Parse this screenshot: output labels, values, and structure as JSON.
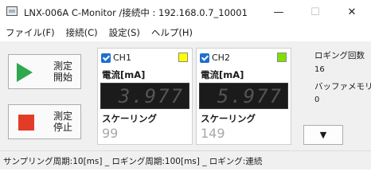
{
  "window": {
    "title": "LNX-006A C-Monitor  /接続中 : 192.168.0.7_10001",
    "minimize_glyph": "—",
    "maximize_glyph": "☐",
    "close_glyph": "✕"
  },
  "menu": [
    "ファイル(F)",
    "接続(C)",
    "設定(S)",
    "ヘルプ(H)"
  ],
  "buttons": {
    "start_label": "測定\n開始",
    "stop_label": "測定\n停止"
  },
  "channels": [
    {
      "name": "CH1",
      "checked": true,
      "color": "#ffff00",
      "quantity": "電流[mA]",
      "value": "3.977",
      "scaling_label": "スケーリング",
      "scaling_value": "99"
    },
    {
      "name": "CH2",
      "checked": true,
      "color": "#7fe000",
      "quantity": "電流[mA]",
      "value": "5.977",
      "scaling_label": "スケーリング",
      "scaling_value": "149"
    }
  ],
  "logging": {
    "count_label": "ロギング回数",
    "count_value": "16",
    "buffer_label": "バッファメモリ",
    "buffer_value": "0",
    "dropdown_glyph": "▼"
  },
  "status": "サンプリング周期:10[ms] _ ロギング周期:100[ms] _ ロギング:連続",
  "colors": {
    "play": "#2fa84e",
    "stop": "#e23b26",
    "display_bg": "#1b1b1b",
    "check": "#1e6fcf"
  }
}
